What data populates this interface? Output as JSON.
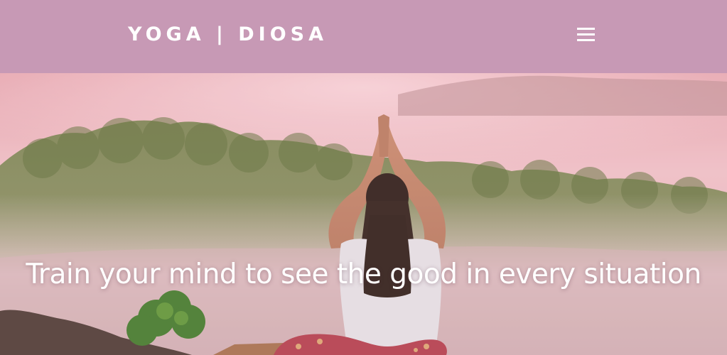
{
  "header": {
    "brand": "YOGA | DIOSA",
    "menu_icon": "hamburger-menu-icon"
  },
  "hero": {
    "tagline": "Train your mind to see the good in every situation"
  },
  "colors": {
    "header_bg": "#c799b5",
    "text": "#ffffff",
    "sky_top": "#e9a6ad",
    "mist": "#f3d2da"
  }
}
